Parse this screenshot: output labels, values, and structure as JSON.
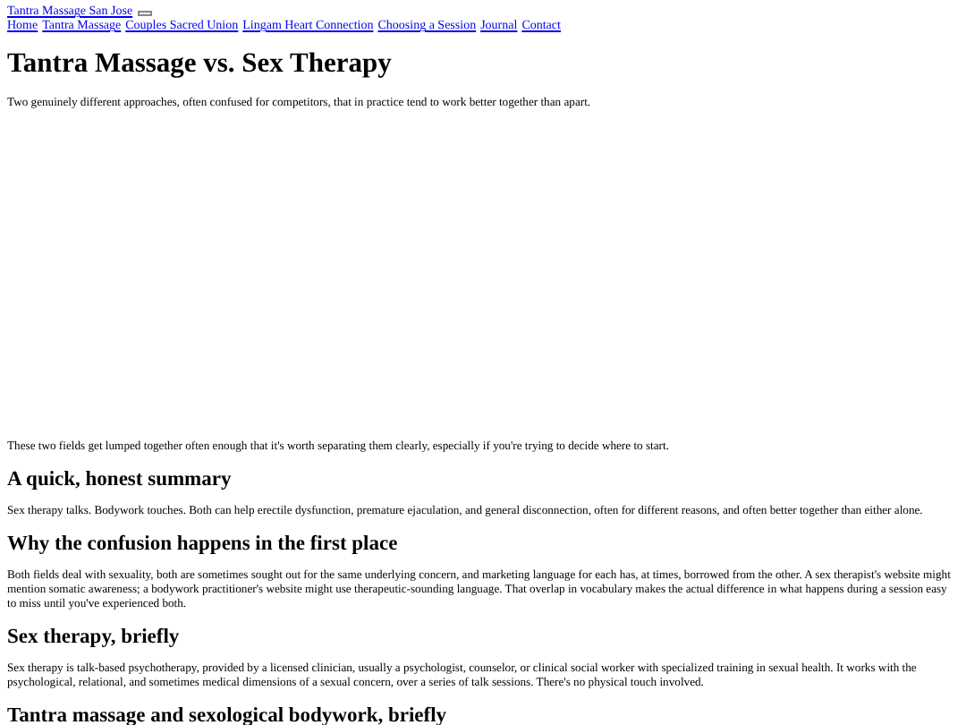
{
  "site_title": "Tantra Massage San Jose",
  "nav": [
    "Home",
    "Tantra Massage",
    "Couples Sacred Union",
    "Lingam Heart Connection",
    "Choosing a Session",
    "Journal",
    "Contact"
  ],
  "title": "Tantra Massage vs. Sex Therapy",
  "intro": "Two genuinely different approaches, often confused for competitors, that in practice tend to work better together than apart.",
  "lead": "These two fields get lumped together often enough that it's worth separating them clearly, especially if you're trying to decide where to start.",
  "sections": [
    {
      "heading": "A quick, honest summary",
      "text": "Sex therapy talks. Bodywork touches. Both can help erectile dysfunction, premature ejaculation, and general disconnection, often for different reasons, and often better together than either alone."
    },
    {
      "heading": "Why the confusion happens in the first place",
      "text": "Both fields deal with sexuality, both are sometimes sought out for the same underlying concern, and marketing language for each has, at times, borrowed from the other. A sex therapist's website might mention somatic awareness; a bodywork practitioner's website might use therapeutic-sounding language. That overlap in vocabulary makes the actual difference in what happens during a session easy to miss until you've experienced both."
    },
    {
      "heading": "Sex therapy, briefly",
      "text": "Sex therapy is talk-based psychotherapy, provided by a licensed clinician, usually a psychologist, counselor, or clinical social worker with specialized training in sexual health. It works with the psychological, relational, and sometimes medical dimensions of a sexual concern, over a series of talk sessions. There's no physical touch involved."
    },
    {
      "heading": "Tantra massage and sexological bodywork, briefly"
    }
  ]
}
